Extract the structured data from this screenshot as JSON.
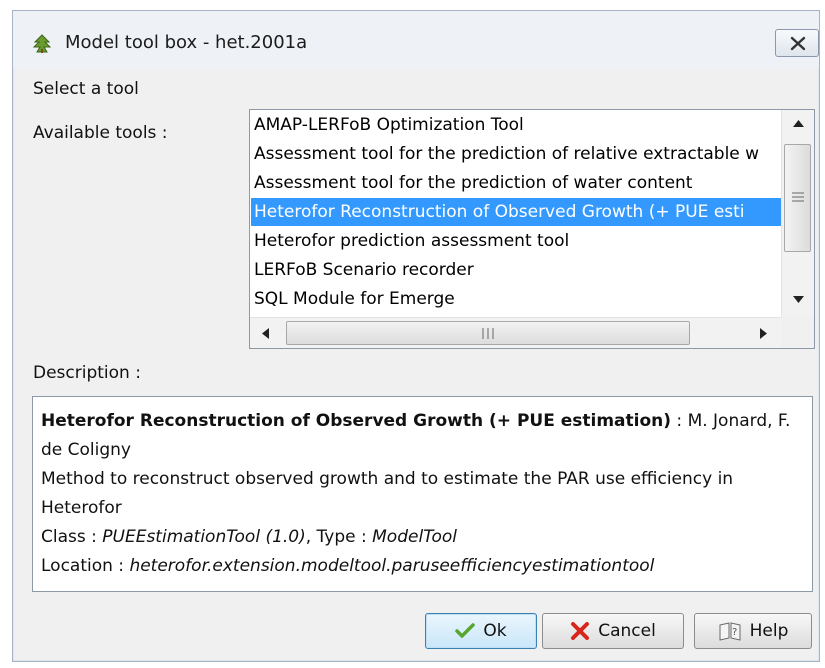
{
  "window": {
    "title": "Model tool box - het.2001a",
    "icon": "pine-tree-icon",
    "close_icon": "close-icon"
  },
  "select_label": "Select a tool",
  "available_label": "Available tools :",
  "tools": [
    {
      "label": "AMAP-LERFoB Optimization Tool",
      "selected": false
    },
    {
      "label": "Assessment tool for the prediction of relative extractable w",
      "selected": false
    },
    {
      "label": "Assessment tool for the prediction of water content",
      "selected": false
    },
    {
      "label": "Heterofor Reconstruction of Observed Growth (+ PUE esti",
      "selected": true
    },
    {
      "label": "Heterofor prediction assessment tool",
      "selected": false
    },
    {
      "label": "LERFoB Scenario recorder",
      "selected": false
    },
    {
      "label": "SQL Module for Emerge",
      "selected": false
    }
  ],
  "description_label": "Description :",
  "description": {
    "name": "Heterofor Reconstruction of Observed Growth (+ PUE estimation)",
    "authors": " : M. Jonard, F. de Coligny",
    "text": "Method to reconstruct observed growth and to estimate the PAR use efficiency in Heterofor",
    "class_label": "Class : ",
    "class_value": "PUEEstimationTool (1.0)",
    "type_label": ", Type : ",
    "type_value": "ModelTool",
    "location_label": "Location : ",
    "location_value": "heterofor.extension.modeltool.paruseefficiencyestimationtool"
  },
  "buttons": {
    "ok": "Ok",
    "cancel": "Cancel",
    "help": "Help"
  },
  "colors": {
    "selection": "#3399ff",
    "ok_check": "#5aa52f",
    "cancel_x": "#d8261c"
  }
}
